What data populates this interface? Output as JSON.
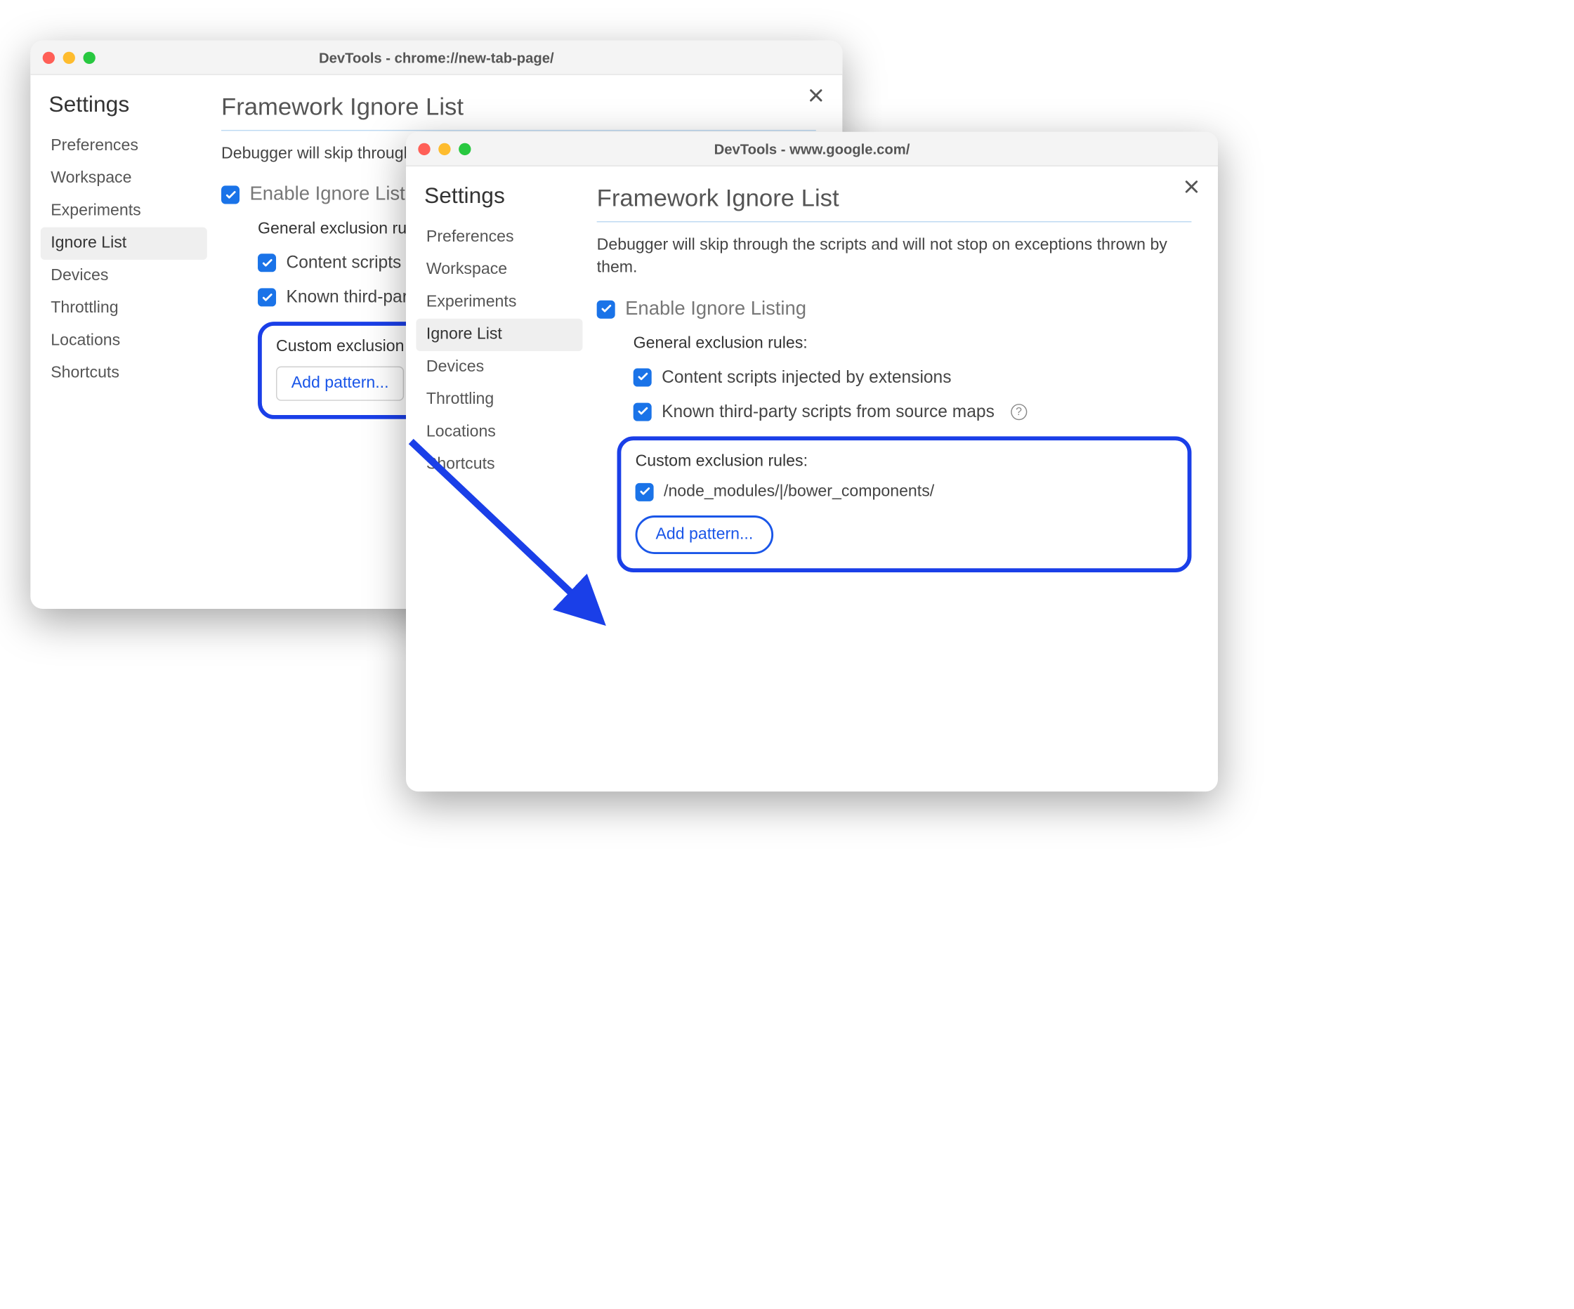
{
  "windows": {
    "a": {
      "title": "DevTools - chrome://new-tab-page/"
    },
    "b": {
      "title": "DevTools - www.google.com/"
    }
  },
  "sidebar": {
    "title": "Settings",
    "items": [
      {
        "label": "Preferences",
        "active": false
      },
      {
        "label": "Workspace",
        "active": false
      },
      {
        "label": "Experiments",
        "active": false
      },
      {
        "label": "Ignore List",
        "active": true
      },
      {
        "label": "Devices",
        "active": false
      },
      {
        "label": "Throttling",
        "active": false
      },
      {
        "label": "Locations",
        "active": false
      },
      {
        "label": "Shortcuts",
        "active": false
      }
    ]
  },
  "panel": {
    "title": "Framework Ignore List",
    "description_full": "Debugger will skip through the scripts and will not stop on exceptions thrown by them.",
    "description_clipped": "Debugger will skip through the scripts thrown by them.",
    "enable_label": "Enable Ignore Listing",
    "general_section": "General exclusion rules:",
    "rule_content_full": "Content scripts injected by extensions",
    "rule_content_clipped": "Content scripts injected by e",
    "rule_third_full": "Known third-party scripts from source maps",
    "rule_third_clipped": "Known third-party scripts fro",
    "custom_section": "Custom exclusion rules:",
    "custom_pattern": "/node_modules/|/bower_components/",
    "add_pattern": "Add pattern...",
    "help_glyph": "?"
  }
}
